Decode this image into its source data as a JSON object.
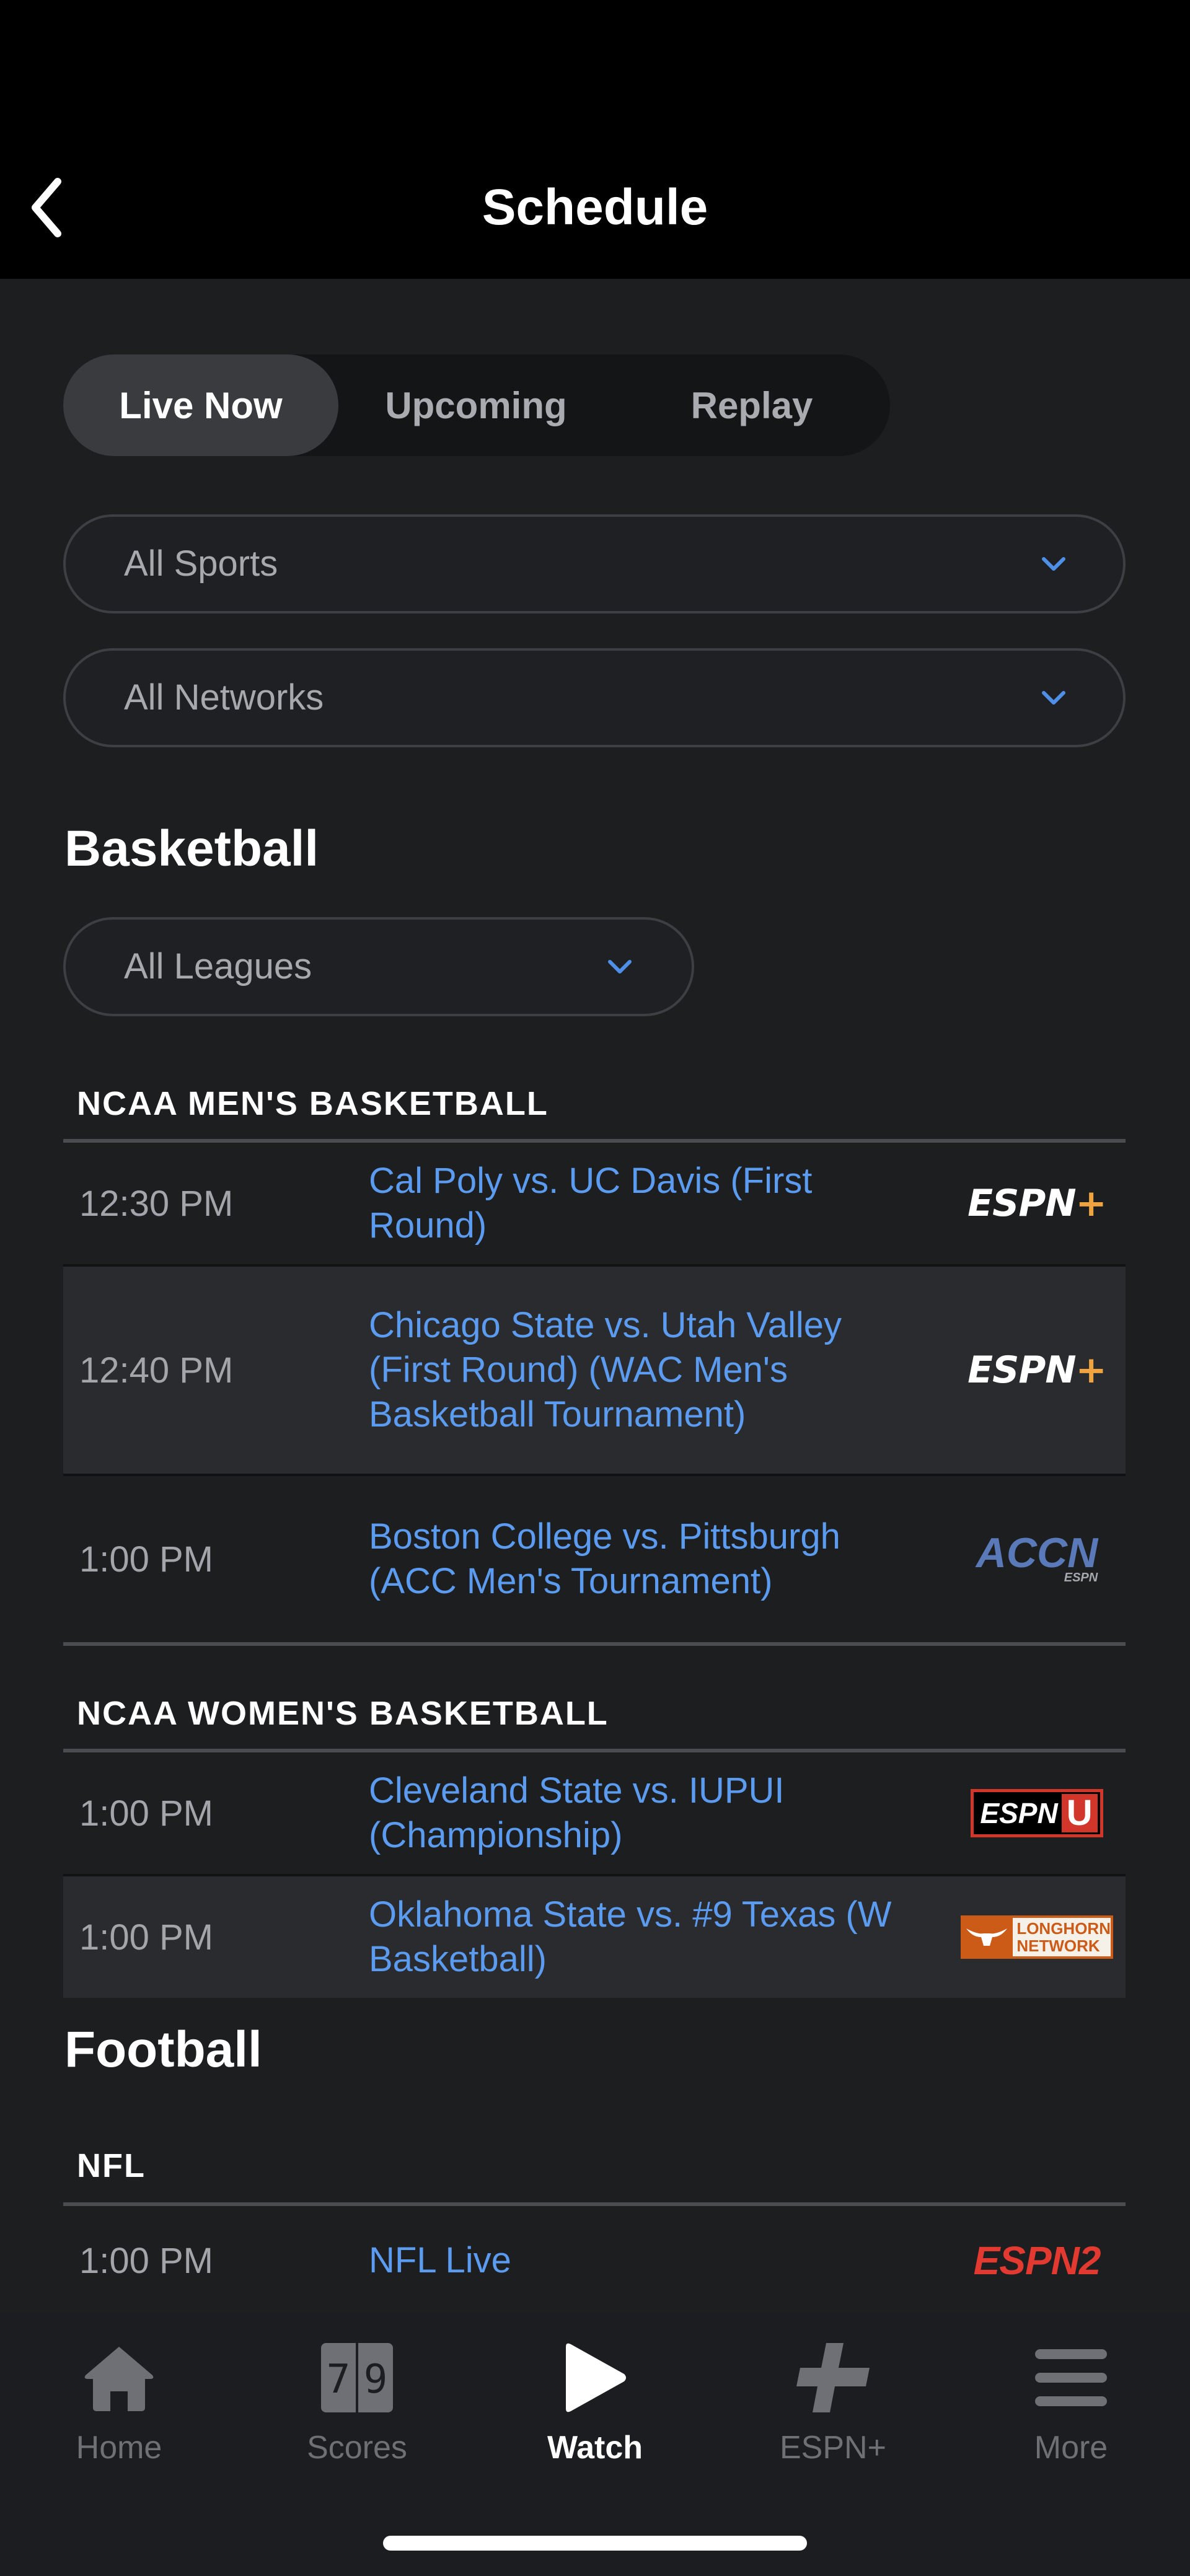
{
  "header": {
    "title": "Schedule",
    "back_icon": "chevron-left-icon"
  },
  "segments": {
    "items": [
      "Live Now",
      "Upcoming",
      "Replay"
    ],
    "active": "Live Now"
  },
  "filters": {
    "sports": "All Sports",
    "networks": "All Networks",
    "leagues": "All Leagues"
  },
  "sections": [
    {
      "title": "Basketball",
      "leagues": [
        {
          "name": "NCAA MEN'S BASKETBALL",
          "events": [
            {
              "time": "12:30 PM",
              "title": "Cal Poly vs. UC Davis (First Round)",
              "network": "ESPN+"
            },
            {
              "time": "12:40 PM",
              "title": "Chicago State vs. Utah Valley (First Round) (WAC Men's Basketball Tournament)",
              "network": "ESPN+"
            },
            {
              "time": "1:00 PM",
              "title": "Boston College vs. Pittsburgh (ACC Men's Tournament)",
              "network": "ACCN"
            }
          ]
        },
        {
          "name": "NCAA WOMEN'S BASKETBALL",
          "events": [
            {
              "time": "1:00 PM",
              "title": "Cleveland State vs. IUPUI (Championship)",
              "network": "ESPNU"
            },
            {
              "time": "1:00 PM",
              "title": "Oklahoma State vs. #9 Texas (W Basketball)",
              "network": "Longhorn Network"
            }
          ]
        }
      ]
    },
    {
      "title": "Football",
      "leagues": [
        {
          "name": "NFL",
          "events": [
            {
              "time": "1:00 PM",
              "title": "NFL Live",
              "network": "ESPN2"
            }
          ]
        }
      ]
    }
  ],
  "logos": {
    "espnplus_text": "ESPN",
    "espnplus_plus": "+",
    "accn_main": "ACCN",
    "accn_sub": "ESPN",
    "espnu_text": "ESPN",
    "espnu_u": "U",
    "longhorn_line1": "LONGHORN",
    "longhorn_line2": "NETWORK",
    "espn2_text": "ESPN2"
  },
  "tabbar": {
    "items": [
      {
        "label": "Home",
        "icon": "home-icon"
      },
      {
        "label": "Scores",
        "icon": "scoreboard-icon"
      },
      {
        "label": "Watch",
        "icon": "play-icon"
      },
      {
        "label": "ESPN+",
        "icon": "plus-icon"
      },
      {
        "label": "More",
        "icon": "menu-icon"
      }
    ],
    "active": "Watch",
    "scores_icon_digits": [
      "7",
      "9"
    ]
  },
  "colors": {
    "link": "#5b9bf0",
    "background": "#1d1e20",
    "accent_orange": "#f0a440",
    "espn_red": "#e23a31"
  }
}
